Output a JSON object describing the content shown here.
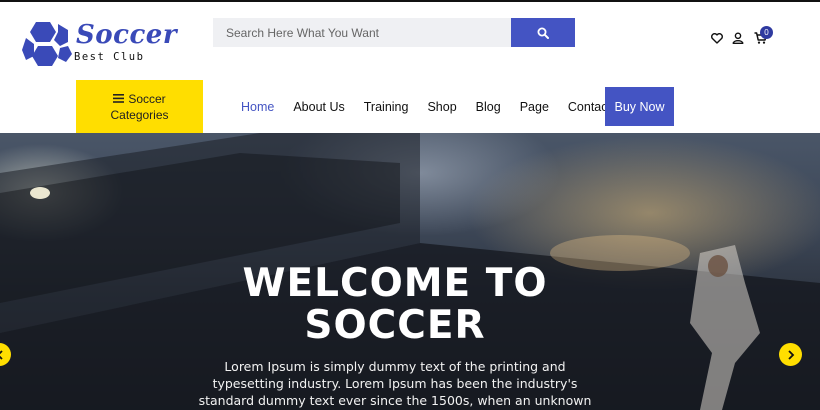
{
  "logo": {
    "word": "Soccer",
    "tagline": "Best Club"
  },
  "search": {
    "placeholder": "Search Here What You Want",
    "value": ""
  },
  "header": {
    "cart_count": "0"
  },
  "categories": {
    "label_line1": "Soccer",
    "label_line2": "Categories"
  },
  "nav": {
    "items": [
      {
        "label": "Home",
        "active": true
      },
      {
        "label": "About Us"
      },
      {
        "label": "Training"
      },
      {
        "label": "Shop"
      },
      {
        "label": "Blog"
      },
      {
        "label": "Page"
      },
      {
        "label": "Contact Us"
      }
    ],
    "cta_label": "Buy Now"
  },
  "hero": {
    "title_line1": "WELCOME TO",
    "title_line2": "SOCCER",
    "text": "Lorem Ipsum is simply dummy text of the printing and typesetting industry. Lorem Ipsum has been the industry's standard dummy text ever since the 1500s, when an unknown printer took a galley"
  },
  "colors": {
    "accent": "#4454c3",
    "highlight": "#ffde00",
    "badge": "#2f3aa0"
  },
  "icons": [
    "soccer-ball-icon",
    "search-icon",
    "heart-icon",
    "user-icon",
    "cart-icon",
    "menu-icon",
    "chevron-left-icon",
    "chevron-right-icon"
  ]
}
